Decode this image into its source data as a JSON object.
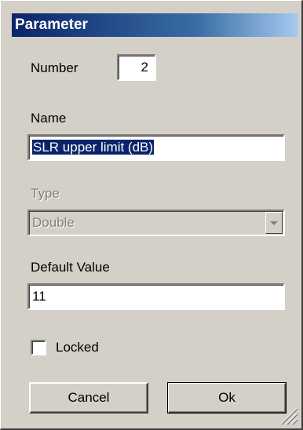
{
  "window": {
    "title": "Parameter"
  },
  "number": {
    "label": "Number",
    "value": "2"
  },
  "name": {
    "label": "Name",
    "value": "SLR upper limit (dB)"
  },
  "type": {
    "label": "Type",
    "selected": "Double"
  },
  "default_value": {
    "label": "Default Value",
    "value": "11"
  },
  "locked": {
    "label": "Locked",
    "checked": false
  },
  "buttons": {
    "cancel": "Cancel",
    "ok": "Ok"
  },
  "colors": {
    "title_start": "#0a246a",
    "title_end": "#a6caf0",
    "face": "#d4d0c8",
    "selection": "#0a246a"
  }
}
